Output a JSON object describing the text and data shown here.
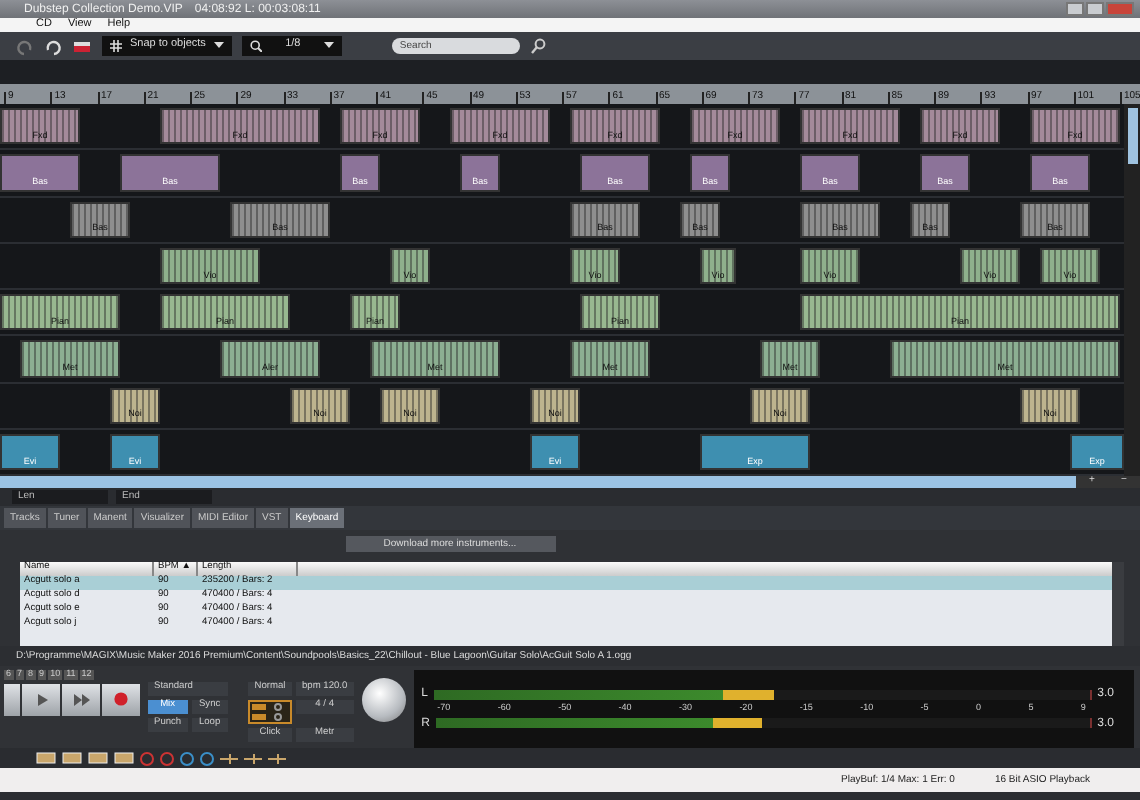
{
  "window": {
    "title": "Dubstep Collection Demo.VIP",
    "time": "04:08:92 L: 00:03:08:11"
  },
  "menu": [
    "CD",
    "View",
    "Help"
  ],
  "toolbar": {
    "snap": "Snap to objects",
    "zoom": "1/8",
    "search": {
      "placeholder": "Search"
    }
  },
  "ruler": [
    "9",
    "13",
    "17",
    "21",
    "25",
    "29",
    "33",
    "37",
    "41",
    "45",
    "49",
    "53",
    "57",
    "61",
    "65",
    "69",
    "73",
    "77",
    "81",
    "85",
    "89",
    "93",
    "97",
    "101",
    "105"
  ],
  "tracks": [
    {
      "color": "#a48a9a",
      "clips": [
        "Fxd",
        "Fxd",
        "Fxd",
        "Fxd",
        "Fxd",
        "Fxd",
        "Fxd",
        "Fxd",
        "Fxd"
      ]
    },
    {
      "color": "#8c7399",
      "clips": [
        "Bas",
        "Bas",
        "Bas",
        "Bas",
        "Bas",
        "Bas",
        "Bas",
        "Bas",
        "Bas"
      ]
    },
    {
      "color": "#8e8e8e",
      "clips": [
        "Bas",
        "Bas",
        "Bas",
        "Bas",
        "Bas",
        "Bas",
        "Bas"
      ]
    },
    {
      "color": "#8fb08c",
      "clips": [
        "Vio",
        "Vio",
        "Vio",
        "Vio",
        "Vio",
        "Vio",
        "Vio"
      ]
    },
    {
      "color": "#98b890",
      "clips": [
        "Pian",
        "Pian",
        "Pian",
        "Pian",
        "Pian"
      ]
    },
    {
      "color": "#8caf92",
      "clips": [
        "Met",
        "Aler",
        "Met",
        "Met",
        "Met",
        "Met"
      ]
    },
    {
      "color": "#bdb48e",
      "clips": [
        "Noi",
        "Noi",
        "Noi",
        "Noi",
        "Noi",
        "Noi"
      ]
    },
    {
      "color": "#3e8fb0",
      "clips": [
        "Evi",
        "Evi",
        "Evi",
        "Exp",
        "Exp"
      ]
    }
  ],
  "scroll_buttons": [
    "+",
    "−"
  ],
  "range": {
    "start": "Len",
    "end": "End"
  },
  "tabs": [
    {
      "label": "Tracks",
      "selected": false
    },
    {
      "label": "Tuner",
      "selected": false
    },
    {
      "label": "Manent",
      "selected": false
    },
    {
      "label": "Visualizer",
      "selected": false
    },
    {
      "label": "MIDI Editor",
      "selected": false
    },
    {
      "label": "VST",
      "selected": false
    },
    {
      "label": "Keyboard",
      "selected": true
    }
  ],
  "download_button": "Download more instruments...",
  "table": {
    "columns": [
      "Name",
      "BPM ▲",
      "Length"
    ],
    "rows": [
      {
        "cells": [
          "Acgutt solo a",
          "90",
          "235200 / Bars: 2"
        ],
        "selected": true
      },
      {
        "cells": [
          "Acgutt solo d",
          "90",
          "470400 / Bars: 4"
        ],
        "selected": false
      },
      {
        "cells": [
          "Acgutt solo e",
          "90",
          "470400 / Bars: 4"
        ],
        "selected": false
      },
      {
        "cells": [
          "Acgutt solo j",
          "90",
          "470400 / Bars: 4"
        ],
        "selected": false
      }
    ]
  },
  "path": "D:\\Programme\\MAGIX\\Music Maker 2016 Premium\\Content\\Soundpools\\Basics_22\\Chillout - Blue Lagoon\\Guitar Solo\\AcGuit Solo A 1.ogg",
  "transport": {
    "markers": [
      "6",
      "7",
      "8",
      "9",
      "10",
      "11",
      "12"
    ],
    "mode": "Standard",
    "buttons": [
      {
        "label": "Mix",
        "selected": true
      },
      {
        "label": "Sync",
        "selected": false
      },
      {
        "label": "Punch",
        "selected": false
      },
      {
        "label": "Loop",
        "selected": false
      }
    ],
    "speed": "Normal",
    "tempo": "bpm 120.0",
    "meter": "4 / 4",
    "options": [
      "Click",
      "Metr"
    ]
  },
  "level_meter": {
    "scale": [
      "-70",
      "-60",
      "-50",
      "-40",
      "-30",
      "-20",
      "-15",
      "-10",
      "-5",
      "0",
      "5",
      "9"
    ],
    "channels": [
      {
        "name": "L",
        "level": 0.52,
        "peak": "3.0"
      },
      {
        "name": "R",
        "level": 0.5,
        "peak": "3.0"
      }
    ]
  },
  "status": [
    "PlayBuf: 1/4 Max: 1 Err: 0",
    "16 Bit ASIO Playback"
  ]
}
